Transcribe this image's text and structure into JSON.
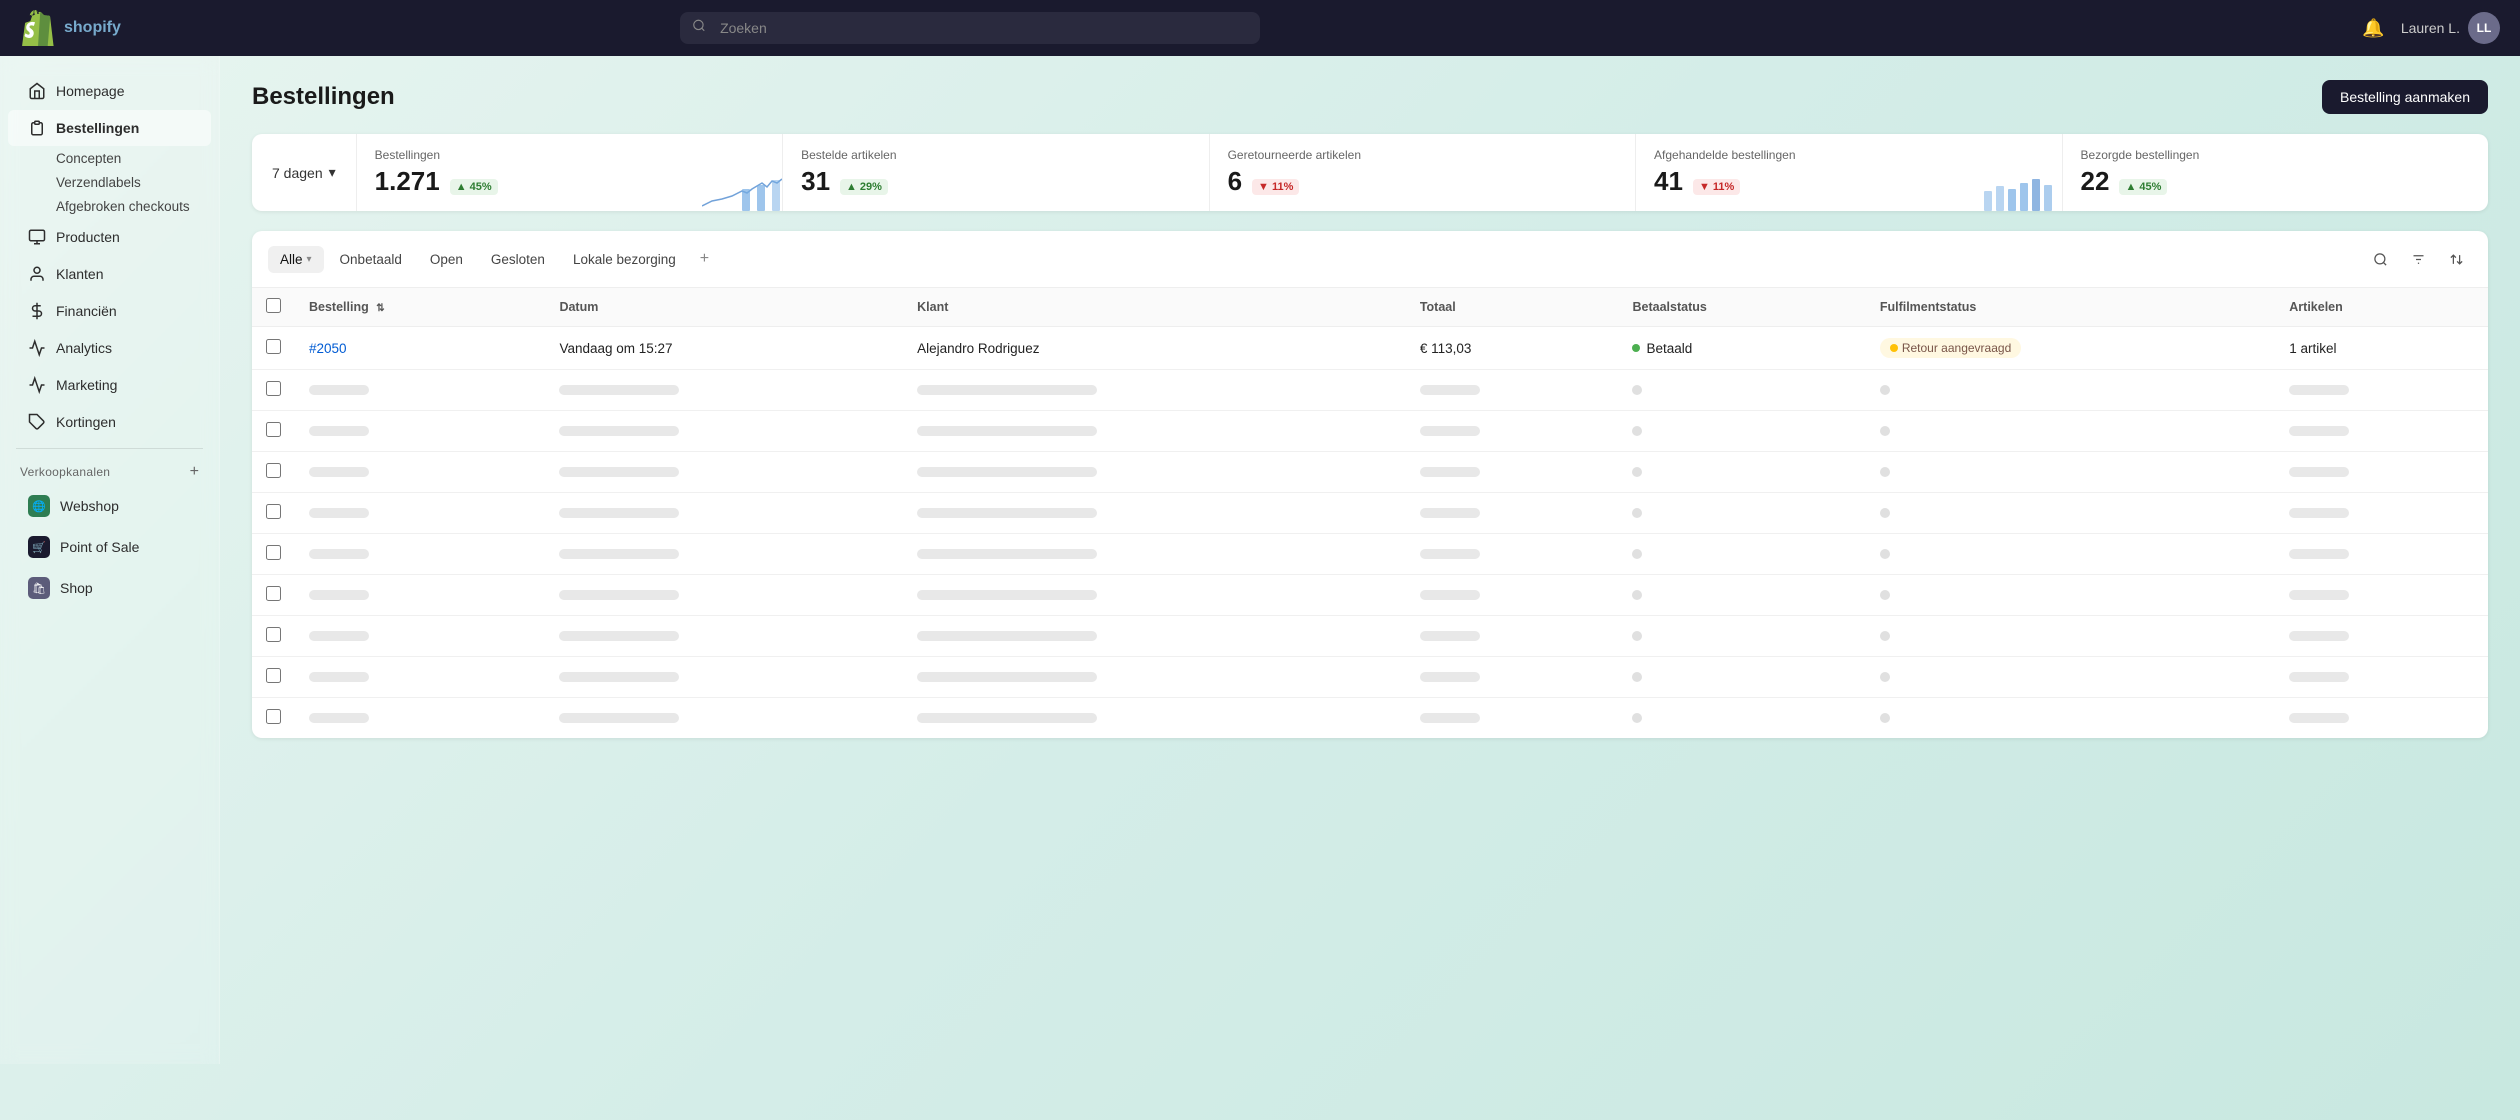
{
  "topnav": {
    "logo_text": "shopify",
    "search_placeholder": "Zoeken",
    "user_name": "Lauren L.",
    "user_initials": "LL",
    "notification_icon": "🔔"
  },
  "sidebar": {
    "items": [
      {
        "id": "homepage",
        "label": "Homepage",
        "icon": "home",
        "active": false
      },
      {
        "id": "bestellingen",
        "label": "Bestellingen",
        "icon": "orders",
        "active": true
      },
      {
        "id": "concepten",
        "label": "Concepten",
        "icon": "",
        "sub": true
      },
      {
        "id": "verzendlabels",
        "label": "Verzendlabels",
        "icon": "",
        "sub": true
      },
      {
        "id": "afgebroken",
        "label": "Afgebroken checkouts",
        "icon": "",
        "sub": true
      },
      {
        "id": "producten",
        "label": "Producten",
        "icon": "products",
        "active": false
      },
      {
        "id": "klanten",
        "label": "Klanten",
        "icon": "customers",
        "active": false
      },
      {
        "id": "financien",
        "label": "Financiën",
        "icon": "finance",
        "active": false
      },
      {
        "id": "analytics",
        "label": "Analytics",
        "icon": "analytics",
        "active": false
      },
      {
        "id": "marketing",
        "label": "Marketing",
        "icon": "marketing",
        "active": false
      },
      {
        "id": "kortingen",
        "label": "Kortingen",
        "icon": "discounts",
        "active": false
      }
    ],
    "sales_channels_label": "Verkoopkanalen",
    "channels": [
      {
        "id": "webshop",
        "label": "Webshop",
        "icon": "webshop"
      },
      {
        "id": "point-of-sale",
        "label": "Point of Sale",
        "icon": "pos"
      },
      {
        "id": "shop",
        "label": "Shop",
        "icon": "shop"
      }
    ]
  },
  "page": {
    "title": "Bestellingen",
    "create_btn": "Bestelling aanmaken"
  },
  "stats": {
    "period": "7 dagen",
    "period_icon": "▾",
    "items": [
      {
        "label": "Bestellingen",
        "value": "1.271",
        "badge": "45%",
        "badge_type": "up",
        "has_chart": true
      },
      {
        "label": "Bestelde artikelen",
        "value": "31",
        "badge": "29%",
        "badge_type": "up",
        "has_chart": false
      },
      {
        "label": "Geretourneerde artikelen",
        "value": "6",
        "badge": "11%",
        "badge_type": "down",
        "has_chart": false
      },
      {
        "label": "Afgehandelde bestellingen",
        "value": "41",
        "badge": "11%",
        "badge_type": "down",
        "has_chart": true
      },
      {
        "label": "Bezorgde bestellingen",
        "value": "22",
        "badge": "45%",
        "badge_type": "up",
        "has_chart": false
      }
    ]
  },
  "table": {
    "tabs": [
      {
        "id": "alle",
        "label": "Alle",
        "active": true,
        "has_dropdown": true
      },
      {
        "id": "onbetaald",
        "label": "Onbetaald",
        "active": false
      },
      {
        "id": "open",
        "label": "Open",
        "active": false
      },
      {
        "id": "gesloten",
        "label": "Gesloten",
        "active": false
      },
      {
        "id": "lokale-bezorging",
        "label": "Lokale bezorging",
        "active": false
      }
    ],
    "plus_btn": "+",
    "columns": [
      {
        "id": "bestelling",
        "label": "Bestelling",
        "sortable": true
      },
      {
        "id": "datum",
        "label": "Datum",
        "sortable": false
      },
      {
        "id": "klant",
        "label": "Klant",
        "sortable": false
      },
      {
        "id": "totaal",
        "label": "Totaal",
        "sortable": false
      },
      {
        "id": "betaalstatus",
        "label": "Betaalstatus",
        "sortable": false
      },
      {
        "id": "fulfilmentstatus",
        "label": "Fulfilmentstatus",
        "sortable": false
      },
      {
        "id": "artikelen",
        "label": "Artikelen",
        "sortable": false
      }
    ],
    "rows": [
      {
        "id": "row-1",
        "bestelling": "#2050",
        "datum": "Vandaag om 15:27",
        "klant": "Alejandro Rodriguez",
        "totaal": "€ 113,03",
        "betaalstatus_dot": "green",
        "betaalstatus": "Betaald",
        "fulfilmentstatus_badge": "Retour aangevraagd",
        "fulfilmentstatus_type": "yellow",
        "artikelen": "1 artikel",
        "skeleton": false
      },
      {
        "id": "row-2",
        "skeleton": true
      },
      {
        "id": "row-3",
        "skeleton": true
      },
      {
        "id": "row-4",
        "skeleton": true
      },
      {
        "id": "row-5",
        "skeleton": true
      },
      {
        "id": "row-6",
        "skeleton": true
      },
      {
        "id": "row-7",
        "skeleton": true
      },
      {
        "id": "row-8",
        "skeleton": true
      },
      {
        "id": "row-9",
        "skeleton": true
      }
    ]
  }
}
